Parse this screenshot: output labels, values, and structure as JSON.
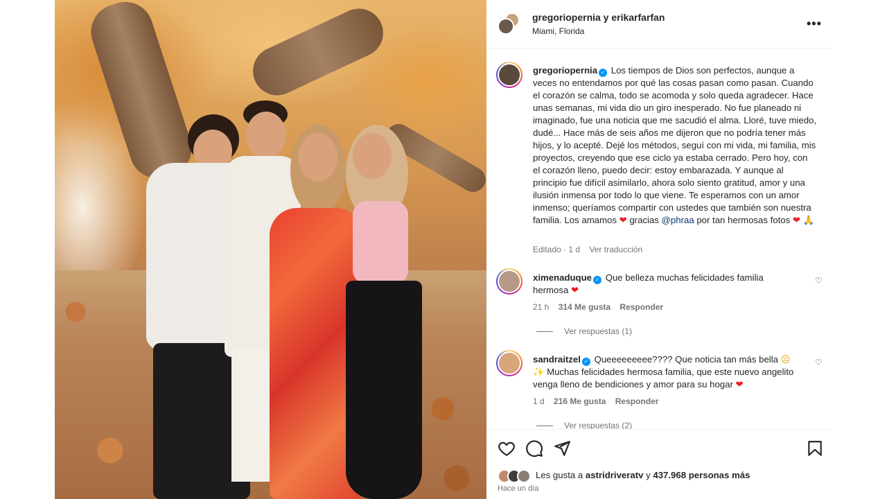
{
  "post": {
    "header": {
      "authors": "gregoriopernia y erikarfarfan",
      "location": "Miami, Florida",
      "more_icon": "more-horizontal-icon"
    },
    "caption": {
      "username": "gregoriopernia",
      "text": "Los tiempos de Dios son perfectos, aunque a veces no entendamos por qué las cosas pasan como pasan. Cuando el corazón se calma, todo se acomoda y solo queda agradecer. Hace unas semanas, mi vida dio un giro inesperado. No fue planeado ni imaginado, fue una noticia que me sacudió el alma. Lloré, tuve miedo, dudé... Hace más de seis años me dijeron que no podría tener más hijos, y lo acepté. Dejé los métodos, seguí con mi vida, mi familia, mis proyectos, creyendo que ese ciclo ya estaba cerrado. Pero hoy, con el corazón lleno, puedo decir: estoy embarazada. Y aunque al principio fue difícil asimilarlo, ahora solo siento gratitud, amor y una ilusión inmensa por todo lo que viene. Te esperamos con un amor inmenso; queríamos compartir con ustedes que también son nuestra familia. Los amamos",
      "after_heart": "gracias",
      "mention": "@phraa",
      "tail": "por tan hermosas fotos",
      "edited": "Editado",
      "age": "1 d",
      "translate": "Ver traducción"
    },
    "comments": [
      {
        "username": "ximenaduque",
        "text": "Que belleza muchas felicidades familia hermosa",
        "age": "21 h",
        "likes": "314 Me gusta",
        "reply": "Responder",
        "view_replies": "Ver respuestas (1)"
      },
      {
        "username": "sandraitzel",
        "text": "Queeeeeeeee???? Que noticia tan más bella",
        "text2": "Muchas felicidades hermosa familia, que este nuevo angelito venga lleno de bendiciones y amor para su hogar",
        "age": "1 d",
        "likes": "216 Me gusta",
        "reply": "Responder",
        "view_replies": "Ver respuestas (2)"
      }
    ],
    "actions": {
      "like_icon": "heart-icon",
      "comment_icon": "comment-icon",
      "share_icon": "send-icon",
      "save_icon": "bookmark-icon"
    },
    "likes": {
      "prefix": "Les gusta a",
      "user": "astridriveratv",
      "connector": "y",
      "count": "437.968 personas más"
    },
    "timestamp": "Hace un día"
  },
  "colors": {
    "verified": "#0095f6",
    "mention": "#00376b",
    "heart": "#ed1c24"
  }
}
